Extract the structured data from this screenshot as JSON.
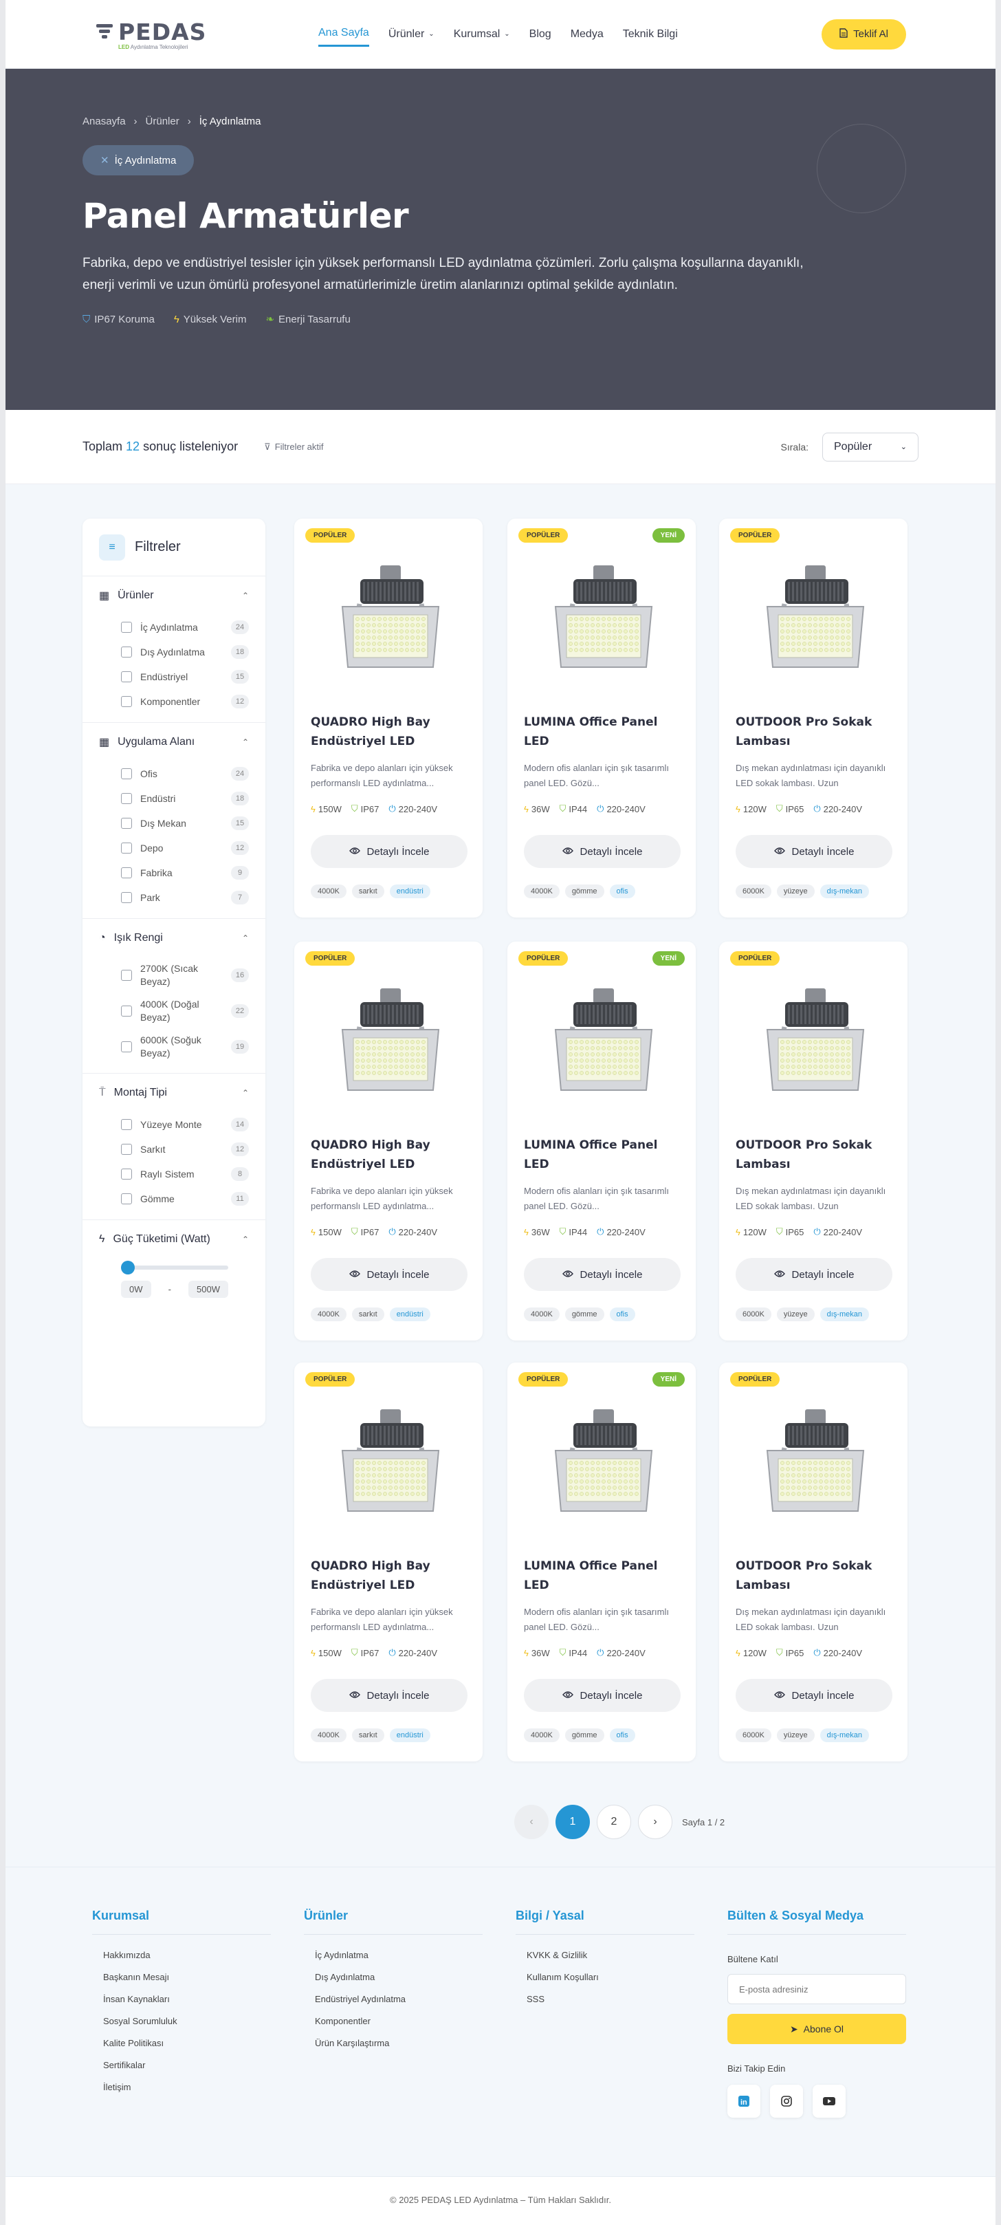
{
  "header": {
    "logo_text": "PEDAS",
    "logo_sub_led": "LED",
    "logo_sub": "Aydınlatma Teknolojileri",
    "nav": [
      {
        "label": "Ana Sayfa"
      },
      {
        "label": "Ürünler"
      },
      {
        "label": "Kurumsal"
      },
      {
        "label": "Blog"
      },
      {
        "label": "Medya"
      },
      {
        "label": "Teknik Bilgi"
      }
    ],
    "quote_label": "Teklif Al"
  },
  "hero": {
    "breadcrumb": [
      "Anasayfa",
      "Ürünler",
      "İç Aydınlatma"
    ],
    "chip": "İç Aydınlatma",
    "title": "Panel Armatürler",
    "description": "Fabrika, depo ve endüstriyel tesisler için yüksek performanslı LED aydınlatma çözümleri. Zorlu çalışma koşullarına dayanıklı, enerji verimli ve uzun ömürlü profesyonel armatürlerimizle üretim alanlarınızı optimal şekilde aydınlatın.",
    "features": [
      "IP67 Koruma",
      "Yüksek Verim",
      "Enerji Tasarrufu"
    ]
  },
  "results": {
    "prefix": "Toplam",
    "count": "12",
    "suffix": "sonuç listeleniyor",
    "filters_active": "Filtreler aktif",
    "sort_label": "Sırala:",
    "sort_value": "Popüler"
  },
  "sidebar": {
    "title": "Filtreler",
    "groups": [
      {
        "title": "Ürünler",
        "options": [
          {
            "label": "İç Aydınlatma",
            "count": "24"
          },
          {
            "label": "Dış Aydınlatma",
            "count": "18"
          },
          {
            "label": "Endüstriyel",
            "count": "15"
          },
          {
            "label": "Komponentler",
            "count": "12"
          }
        ]
      },
      {
        "title": "Uygulama Alanı",
        "options": [
          {
            "label": "Ofis",
            "count": "24"
          },
          {
            "label": "Endüstri",
            "count": "18"
          },
          {
            "label": "Dış Mekan",
            "count": "15"
          },
          {
            "label": "Depo",
            "count": "12"
          },
          {
            "label": "Fabrika",
            "count": "9"
          },
          {
            "label": "Park",
            "count": "7"
          }
        ]
      },
      {
        "title": "Işık Rengi",
        "options": [
          {
            "label": "2700K (Sıcak Beyaz)",
            "count": "16"
          },
          {
            "label": "4000K (Doğal Beyaz)",
            "count": "22"
          },
          {
            "label": "6000K (Soğuk Beyaz)",
            "count": "19"
          }
        ]
      },
      {
        "title": "Montaj Tipi",
        "options": [
          {
            "label": "Yüzeye Monte",
            "count": "14"
          },
          {
            "label": "Sarkıt",
            "count": "12"
          },
          {
            "label": "Raylı Sistem",
            "count": "8"
          },
          {
            "label": "Gömme",
            "count": "11"
          }
        ]
      }
    ],
    "power": {
      "title": "Güç Tüketimi (Watt)",
      "min": "0W",
      "max": "500W",
      "level": 0
    }
  },
  "products": [
    {
      "badge": "POPÜLER",
      "new": "",
      "title": "QUADRO High Bay Endüstriyel LED",
      "desc": "Fabrika ve depo alanları için yüksek performanslı LED aydınlatma...",
      "power": "150W",
      "ip": "IP67",
      "voltage": "220-240V",
      "button": "Detaylı İncele",
      "tags": [
        "4000K",
        "sarkıt",
        "endüstri"
      ]
    },
    {
      "badge": "POPÜLER",
      "new": "YENİ",
      "title": "LUMINA Office Panel LED",
      "desc": "Modern ofis alanları için şık tasarımlı panel LED. Gözü...",
      "power": "36W",
      "ip": "IP44",
      "voltage": "220-240V",
      "button": "Detaylı İncele",
      "tags": [
        "4000K",
        "gömme",
        "ofis"
      ]
    },
    {
      "badge": "POPÜLER",
      "new": "",
      "title": "OUTDOOR Pro Sokak Lambası",
      "desc": "Dış mekan aydınlatması için dayanıklı LED sokak lambası. Uzun",
      "power": "120W",
      "ip": "IP65",
      "voltage": "220-240V",
      "button": "Detaylı İncele",
      "tags": [
        "6000K",
        "yüzeye",
        "dış-mekan"
      ]
    },
    {
      "badge": "POPÜLER",
      "new": "",
      "title": "QUADRO High Bay Endüstriyel LED",
      "desc": "Fabrika ve depo alanları için yüksek performanslı LED aydınlatma...",
      "power": "150W",
      "ip": "IP67",
      "voltage": "220-240V",
      "button": "Detaylı İncele",
      "tags": [
        "4000K",
        "sarkıt",
        "endüstri"
      ]
    },
    {
      "badge": "POPÜLER",
      "new": "YENİ",
      "title": "LUMINA Office Panel LED",
      "desc": "Modern ofis alanları için şık tasarımlı panel LED. Gözü...",
      "power": "36W",
      "ip": "IP44",
      "voltage": "220-240V",
      "button": "Detaylı İncele",
      "tags": [
        "4000K",
        "gömme",
        "ofis"
      ]
    },
    {
      "badge": "POPÜLER",
      "new": "",
      "title": "OUTDOOR Pro Sokak Lambası",
      "desc": "Dış mekan aydınlatması için dayanıklı LED sokak lambası. Uzun",
      "power": "120W",
      "ip": "IP65",
      "voltage": "220-240V",
      "button": "Detaylı İncele",
      "tags": [
        "6000K",
        "yüzeye",
        "dış-mekan"
      ]
    },
    {
      "badge": "POPÜLER",
      "new": "",
      "title": "QUADRO High Bay Endüstriyel LED",
      "desc": "Fabrika ve depo alanları için yüksek performanslı LED aydınlatma...",
      "power": "150W",
      "ip": "IP67",
      "voltage": "220-240V",
      "button": "Detaylı İncele",
      "tags": [
        "4000K",
        "sarkıt",
        "endüstri"
      ]
    },
    {
      "badge": "POPÜLER",
      "new": "YENİ",
      "title": "LUMINA Office Panel LED",
      "desc": "Modern ofis alanları için şık tasarımlı panel LED. Gözü...",
      "power": "36W",
      "ip": "IP44",
      "voltage": "220-240V",
      "button": "Detaylı İncele",
      "tags": [
        "4000K",
        "gömme",
        "ofis"
      ]
    },
    {
      "badge": "POPÜLER",
      "new": "",
      "title": "OUTDOOR Pro Sokak Lambası",
      "desc": "Dış mekan aydınlatması için dayanıklı LED sokak lambası. Uzun",
      "power": "120W",
      "ip": "IP65",
      "voltage": "220-240V",
      "button": "Detaylı İncele",
      "tags": [
        "6000K",
        "yüzeye",
        "dış-mekan"
      ]
    }
  ],
  "pagination": {
    "prev": "‹",
    "pages": [
      "1",
      "2"
    ],
    "current": "1",
    "next": "›",
    "info": "Sayfa 1 / 2"
  },
  "footer": {
    "corporate": {
      "title": "Kurumsal",
      "links": [
        "Hakkımızda",
        "Başkanın Mesajı",
        "İnsan Kaynakları",
        "Sosyal Sorumluluk",
        "Kalite Politikası",
        "Sertifikalar",
        "İletişim"
      ]
    },
    "products": {
      "title": "Ürünler",
      "links": [
        "İç Aydınlatma",
        "Dış Aydınlatma",
        "Endüstriyel Aydınlatma",
        "Komponentler",
        "Ürün Karşılaştırma"
      ]
    },
    "legal": {
      "title": "Bilgi / Yasal",
      "links": [
        "KVKK & Gizlilik",
        "Kullanım Koşulları",
        "SSS"
      ]
    },
    "newsletter": {
      "title": "Bülten & Sosyal Medya",
      "label": "Bültene Katıl",
      "placeholder": "E-posta adresiniz",
      "button": "Abone Ol",
      "follow": "Bizi Takip Edin"
    },
    "copyright": "© 2025 PEDAŞ LED Aydınlatma – Tüm Hakları Saklıdır."
  },
  "colors": {
    "accent": "#2596d4",
    "yellow": "#ffd93d",
    "green": "#7cbf3e",
    "hero_bg": "#4b4d5b"
  }
}
